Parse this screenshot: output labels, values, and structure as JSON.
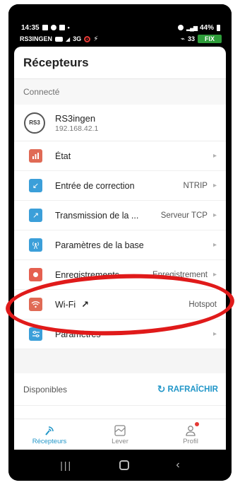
{
  "status_bar": {
    "time": "14:35",
    "device_label": "RS3INGEN",
    "network": "3G",
    "battery": "44%",
    "sat_count": "33",
    "fix_label": "FIX"
  },
  "app": {
    "title": "Récepteurs",
    "connected_label": "Connecté",
    "device": {
      "badge": "RS3",
      "name": "RS3ingen",
      "ip": "192.168.42.1"
    },
    "menu": [
      {
        "label": "État",
        "value": "",
        "icon": "bar-chart-icon",
        "color": "#e06a55"
      },
      {
        "label": "Entrée de correction",
        "value": "NTRIP",
        "icon": "arrow-down-left-icon",
        "color": "#3b9fd9"
      },
      {
        "label": "Transmission de la ...",
        "value": "Serveur TCP",
        "icon": "arrow-up-right-icon",
        "color": "#3b9fd9"
      },
      {
        "label": "Paramètres de la base",
        "value": "",
        "icon": "antenna-icon",
        "color": "#3b9fd9"
      },
      {
        "label": "Enregistrements",
        "value": "Enregistrement",
        "icon": "record-icon",
        "color": "#e56050"
      },
      {
        "label": "Wi-Fi",
        "value": "Hotspot",
        "icon": "wifi-icon",
        "color": "#e06a55"
      },
      {
        "label": "Paramètres",
        "value": "",
        "icon": "sliders-icon",
        "color": "#3b9fd9"
      }
    ],
    "available_label": "Disponibles",
    "refresh_label": "RAFRAÎCHIR",
    "nav": [
      {
        "label": "Récepteurs",
        "icon": "receiver-icon"
      },
      {
        "label": "Lever",
        "icon": "survey-icon"
      },
      {
        "label": "Profil",
        "icon": "profile-icon"
      }
    ]
  },
  "colors": {
    "accent": "#2196c8",
    "fix": "#2e9d3a",
    "annotation": "#e01a1a"
  }
}
